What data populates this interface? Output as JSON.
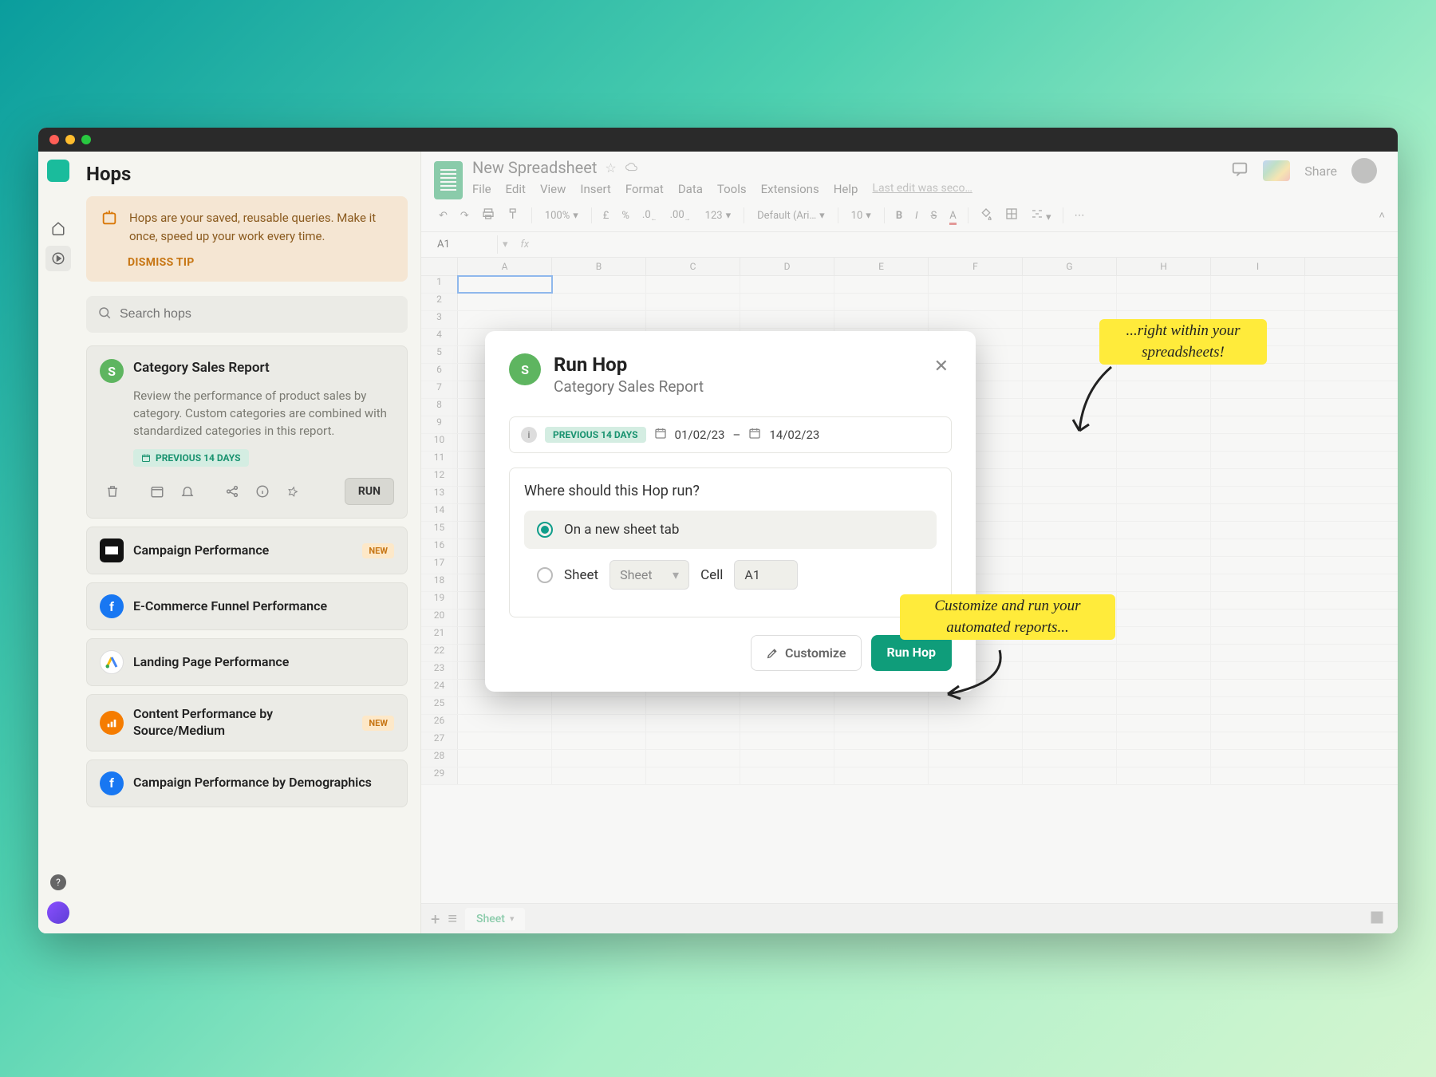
{
  "sidebar": {
    "title": "Hops",
    "tip": {
      "text": "Hops are your saved, reusable queries. Make it once, speed up your work every time.",
      "dismiss": "DISMISS TIP"
    },
    "search_placeholder": "Search hops",
    "featured": {
      "title": "Category Sales Report",
      "desc": "Review the performance of product sales by category. Custom categories are combined with standardized categories in this report.",
      "badge": "PREVIOUS 14 DAYS",
      "run": "RUN"
    },
    "items": [
      {
        "title": "Campaign Performance",
        "badge": "NEW"
      },
      {
        "title": "E-Commerce Funnel Performance",
        "badge": ""
      },
      {
        "title": "Landing Page Performance",
        "badge": ""
      },
      {
        "title": "Content Performance by Source/Medium",
        "badge": "NEW"
      },
      {
        "title": "Campaign Performance by Demographics",
        "badge": ""
      }
    ]
  },
  "sheets": {
    "title": "New Spreadsheet",
    "menu": [
      "File",
      "Edit",
      "View",
      "Insert",
      "Format",
      "Data",
      "Tools",
      "Extensions",
      "Help"
    ],
    "last_edit": "Last edit was seco…",
    "share": "Share",
    "zoom": "100%",
    "font": "Default (Ari…",
    "fontsize": "10",
    "number_fmt": "123",
    "cell_name": "A1",
    "cols": [
      "A",
      "B",
      "C",
      "D",
      "E",
      "F",
      "G",
      "H",
      "I"
    ],
    "tab": "Sheet"
  },
  "modal": {
    "title": "Run Hop",
    "subtitle": "Category Sales Report",
    "prev_label": "PREVIOUS 14 DAYS",
    "date_from": "01/02/23",
    "date_sep": "–",
    "date_to": "14/02/23",
    "question": "Where should this Hop run?",
    "opt_new": "On a new sheet tab",
    "opt_sheet_label": "Sheet",
    "opt_sheet_value": "Sheet",
    "opt_cell_label": "Cell",
    "opt_cell_value": "A1",
    "customize": "Customize",
    "run": "Run Hop"
  },
  "annotations": {
    "top": "...right within your spreadsheets!",
    "bottom": "Customize and run your automated reports..."
  }
}
